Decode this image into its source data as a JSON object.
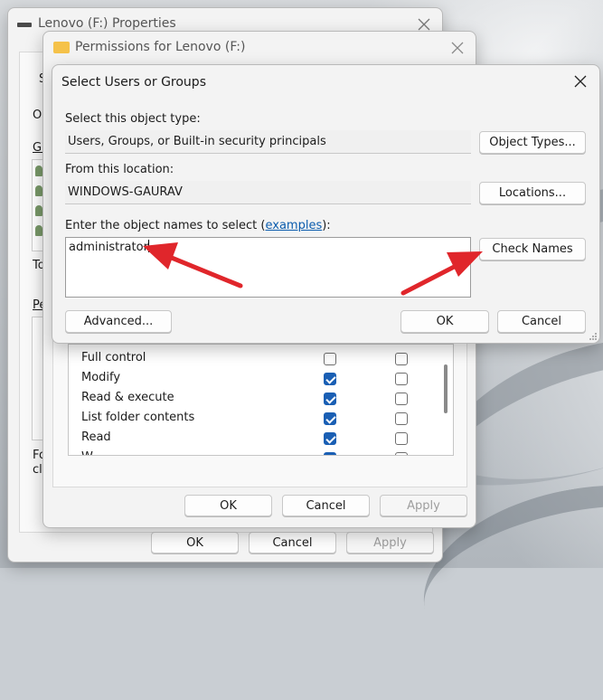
{
  "properties_window": {
    "title": "Lenovo (F:) Properties",
    "cut_labels": [
      "S",
      "Ob",
      "Gr",
      "To",
      "Pe",
      "Fo",
      "cli"
    ],
    "ok_label": "OK",
    "cancel_label": "Cancel",
    "apply_label": "Apply"
  },
  "permissions_window": {
    "title": "Permissions for Lenovo (F:)",
    "permissions": [
      {
        "name": "Full control",
        "allow": false,
        "deny": false
      },
      {
        "name": "Modify",
        "allow": true,
        "deny": false
      },
      {
        "name": "Read & execute",
        "allow": true,
        "deny": false
      },
      {
        "name": "List folder contents",
        "allow": true,
        "deny": false
      },
      {
        "name": "Read",
        "allow": true,
        "deny": false
      },
      {
        "name": "W...",
        "allow": true,
        "deny": false
      }
    ],
    "ok_label": "OK",
    "cancel_label": "Cancel",
    "apply_label": "Apply"
  },
  "select_dialog": {
    "title": "Select Users or Groups",
    "object_type_label": "Select this object type:",
    "object_type_value": "Users, Groups, or Built-in security principals",
    "object_types_button": "Object Types...",
    "location_label": "From this location:",
    "location_value": "WINDOWS-GAURAV",
    "locations_button": "Locations...",
    "names_label_prefix": "Enter the object names to select (",
    "names_label_link": "examples",
    "names_label_suffix": "):",
    "names_value": "administrator",
    "check_names_button": "Check Names",
    "advanced_button": "Advanced...",
    "ok_button": "OK",
    "cancel_button": "Cancel"
  },
  "colors": {
    "arrow": "#e0262b",
    "link": "#0b5cad",
    "checkbox_checked": "#1a5fb4"
  }
}
